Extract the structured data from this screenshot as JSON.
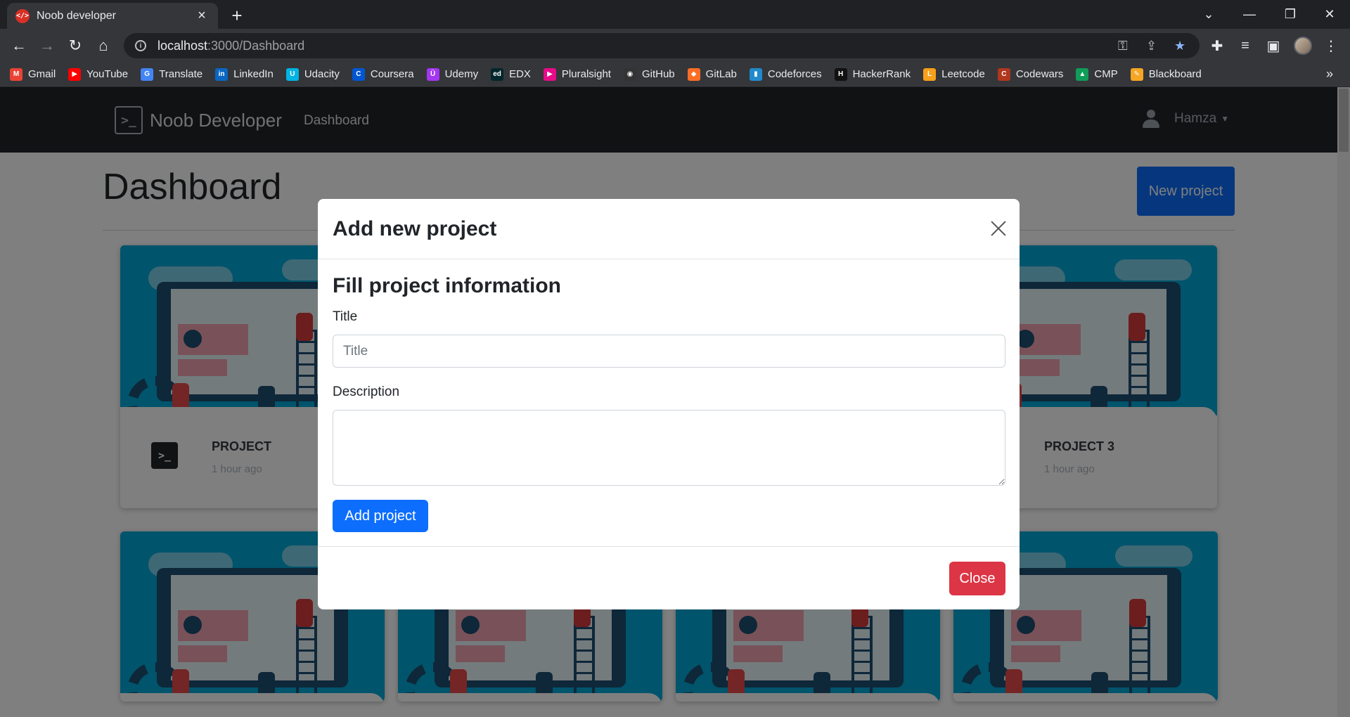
{
  "browser": {
    "tab_title": "Noob developer",
    "tab_favicon_text": "</>",
    "url_host": "localhost",
    "url_path": ":3000/Dashboard",
    "bookmarks": [
      {
        "label": "Gmail",
        "icon": "gmail-icon",
        "color": "#ea4335",
        "glyph": "M"
      },
      {
        "label": "YouTube",
        "icon": "youtube-icon",
        "color": "#ff0000",
        "glyph": "▶"
      },
      {
        "label": "Translate",
        "icon": "translate-icon",
        "color": "#4285f4",
        "glyph": "G"
      },
      {
        "label": "LinkedIn",
        "icon": "linkedin-icon",
        "color": "#0a66c2",
        "glyph": "in"
      },
      {
        "label": "Udacity",
        "icon": "udacity-icon",
        "color": "#02b3e4",
        "glyph": "U"
      },
      {
        "label": "Coursera",
        "icon": "coursera-icon",
        "color": "#0056d2",
        "glyph": "C"
      },
      {
        "label": "Udemy",
        "icon": "udemy-icon",
        "color": "#a435f0",
        "glyph": "Ü"
      },
      {
        "label": "EDX",
        "icon": "edx-icon",
        "color": "#02262b",
        "glyph": "ed"
      },
      {
        "label": "Pluralsight",
        "icon": "pluralsight-icon",
        "color": "#e80a89",
        "glyph": "▶"
      },
      {
        "label": "GitHub",
        "icon": "github-icon",
        "color": "#333333",
        "glyph": "◉"
      },
      {
        "label": "GitLab",
        "icon": "gitlab-icon",
        "color": "#fc6d26",
        "glyph": "◆"
      },
      {
        "label": "Codeforces",
        "icon": "codeforces-icon",
        "color": "#1f8acb",
        "glyph": "▮"
      },
      {
        "label": "HackerRank",
        "icon": "hackerrank-icon",
        "color": "#111111",
        "glyph": "H"
      },
      {
        "label": "Leetcode",
        "icon": "leetcode-icon",
        "color": "#f89f1b",
        "glyph": "L"
      },
      {
        "label": "Codewars",
        "icon": "codewars-icon",
        "color": "#b1361e",
        "glyph": "C"
      },
      {
        "label": "CMP",
        "icon": "google-drive-icon",
        "color": "#0f9d58",
        "glyph": "▲"
      },
      {
        "label": "Blackboard",
        "icon": "blackboard-icon",
        "color": "#f5a623",
        "glyph": "✎"
      }
    ],
    "bookmarks_more": "»"
  },
  "app": {
    "brand_icon_text": ">_",
    "brand_name": "Noob Developer",
    "nav_dashboard": "Dashboard",
    "user_name": "Hamza"
  },
  "dashboard": {
    "title": "Dashboard",
    "new_project_label": "New project",
    "cards_top": [
      {
        "title": "PROJECT",
        "time": "1 hour ago"
      },
      {
        "title": "PROJECT 3",
        "time": "1 hour ago"
      }
    ]
  },
  "modal": {
    "title": "Add new project",
    "form_heading": "Fill project information",
    "title_label": "Title",
    "title_placeholder": "Title",
    "description_label": "Description",
    "add_button": "Add project",
    "close_button": "Close"
  },
  "colors": {
    "primary": "#0d6efd",
    "danger": "#dc3545",
    "navbar": "#212529",
    "card_image": "#00a9d6"
  }
}
